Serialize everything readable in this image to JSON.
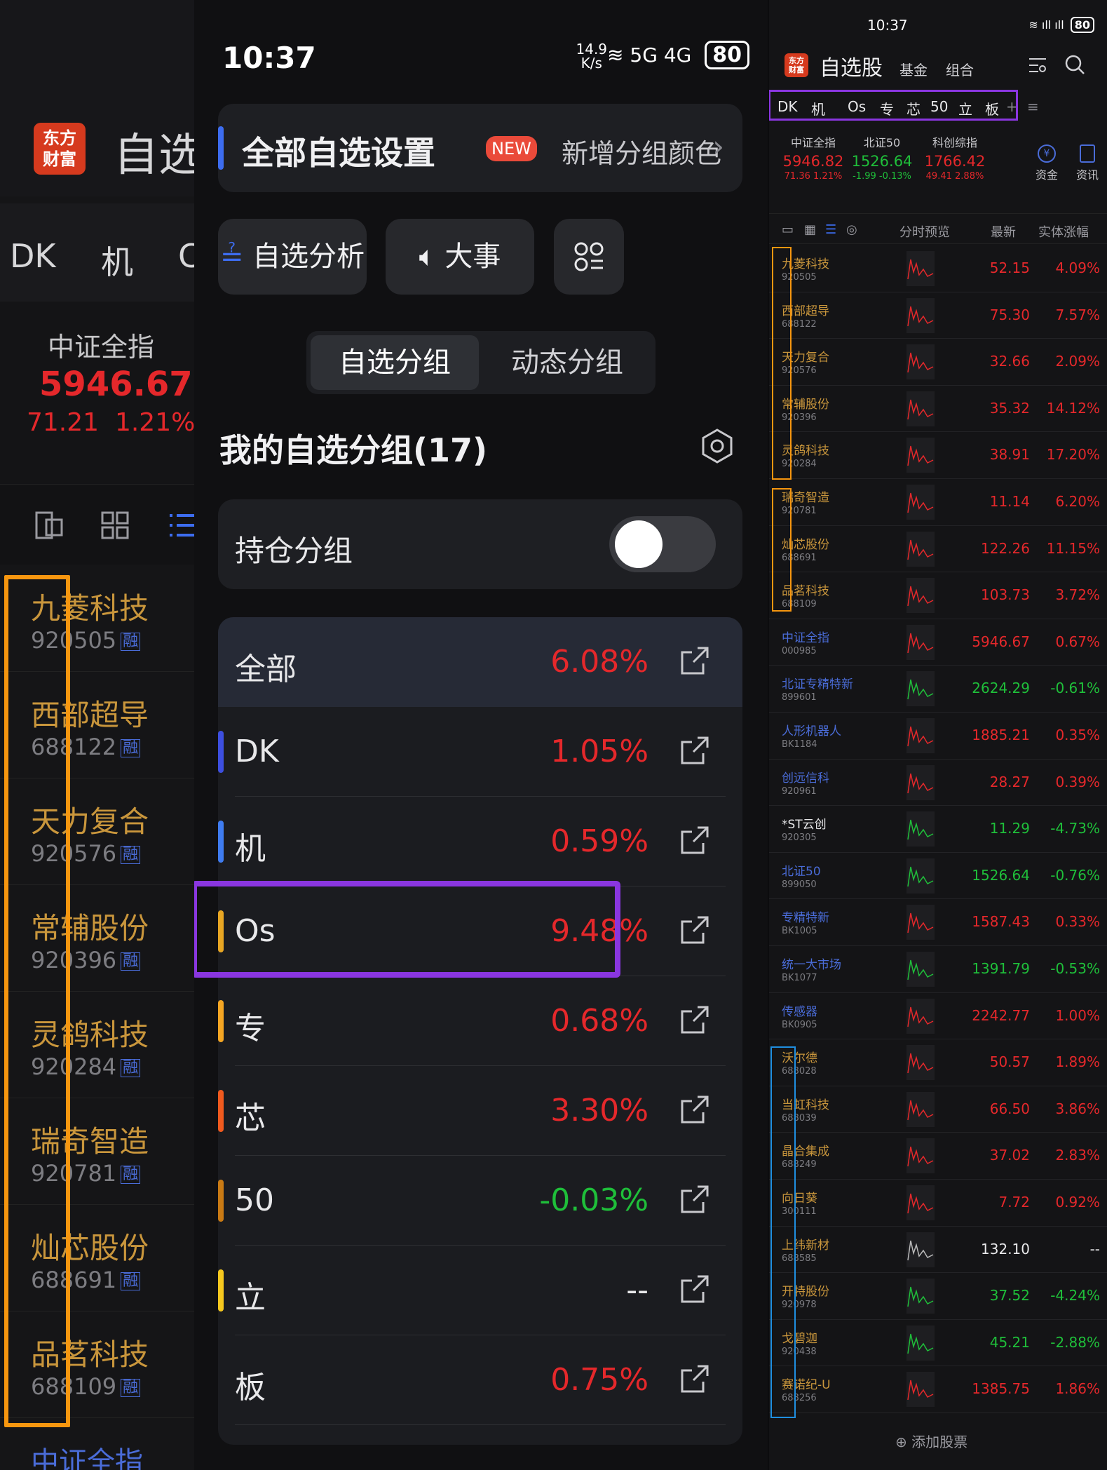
{
  "left": {
    "logo": "东方\n财富",
    "app_title": "自选",
    "tabs": [
      "DK",
      "机",
      "C"
    ],
    "index": {
      "name": "中证全指",
      "price": "5946.67",
      "change": "71.21",
      "pct": "1.21%"
    },
    "stocks": [
      {
        "name": "九菱科技",
        "code": "920505",
        "tag": "融"
      },
      {
        "name": "西部超导",
        "code": "688122",
        "tag": "融"
      },
      {
        "name": "天力复合",
        "code": "920576",
        "tag": "融"
      },
      {
        "name": "常辅股份",
        "code": "920396",
        "tag": "融"
      },
      {
        "name": "灵鸽科技",
        "code": "920284",
        "tag": "融"
      },
      {
        "name": "瑞奇智造",
        "code": "920781",
        "tag": "融"
      },
      {
        "name": "灿芯股份",
        "code": "688691",
        "tag": "融"
      },
      {
        "name": "品茗科技",
        "code": "688109",
        "tag": "融"
      }
    ],
    "bottom_item": "中证全指"
  },
  "mid": {
    "time": "10:37",
    "net_speed": "14.9\nK/s",
    "signal": "5G 4G",
    "battery": "80",
    "settings_title": "全部自选设置",
    "new_badge": "NEW",
    "new_text": "新增分组颜色",
    "btn_analysis": "自选分析",
    "btn_events": "大事",
    "seg_left": "自选分组",
    "seg_right": "动态分组",
    "my_groups": "我的自选分组(17)",
    "hold_group": "持仓分组",
    "groups": [
      {
        "name": "全部",
        "pct": "6.08%",
        "color": "",
        "tone": "red"
      },
      {
        "name": "DK",
        "pct": "1.05%",
        "color": "#3d4fe0",
        "tone": "red"
      },
      {
        "name": "机",
        "pct": "0.59%",
        "color": "#3f7cf0",
        "tone": "red"
      },
      {
        "name": "Os",
        "pct": "9.48%",
        "color": "#e8a623",
        "tone": "red"
      },
      {
        "name": "专",
        "pct": "0.68%",
        "color": "#f5a623",
        "tone": "red"
      },
      {
        "name": "芯",
        "pct": "3.30%",
        "color": "#f05a1e",
        "tone": "red"
      },
      {
        "name": "50",
        "pct": "-0.03%",
        "color": "#c97a14",
        "tone": "green"
      },
      {
        "name": "立",
        "pct": "--",
        "color": "#f6c81e",
        "tone": "white"
      },
      {
        "name": "板",
        "pct": "0.75%",
        "color": "",
        "tone": "red"
      }
    ]
  },
  "right": {
    "time": "10:37",
    "battery": "80",
    "logo": "东方\n财富",
    "title": "自选股",
    "sub_fund": "基金",
    "sub_combo": "组合",
    "tabs": [
      "DK",
      "机",
      "Os",
      "专",
      "芯",
      "50",
      "立",
      "板",
      "+",
      "≡"
    ],
    "indices": [
      {
        "name": "中证全指",
        "price": "5946.82",
        "chg": "71.36",
        "pct": "1.21%",
        "tone": "red"
      },
      {
        "name": "北证50",
        "price": "1526.64",
        "chg": "-1.99",
        "pct": "-0.13%",
        "tone": "green"
      },
      {
        "name": "科创综指",
        "price": "1766.42",
        "chg": "49.41",
        "pct": "2.88%",
        "tone": "red"
      }
    ],
    "fund_label": "资金",
    "news_label": "资讯",
    "col_preview": "分时预览",
    "col_latest": "最新",
    "col_change": "实体涨幅",
    "rows": [
      {
        "name": "九菱科技",
        "code": "920505",
        "price": "52.15",
        "pct": "4.09%",
        "tone": "red",
        "kind": "gold"
      },
      {
        "name": "西部超导",
        "code": "688122",
        "price": "75.30",
        "pct": "7.57%",
        "tone": "red",
        "kind": "gold"
      },
      {
        "name": "天力复合",
        "code": "920576",
        "price": "32.66",
        "pct": "2.09%",
        "tone": "red",
        "kind": "gold"
      },
      {
        "name": "常辅股份",
        "code": "920396",
        "price": "35.32",
        "pct": "14.12%",
        "tone": "red",
        "kind": "gold"
      },
      {
        "name": "灵鸽科技",
        "code": "920284",
        "price": "38.91",
        "pct": "17.20%",
        "tone": "red",
        "kind": "gold"
      },
      {
        "name": "瑞奇智造",
        "code": "920781",
        "price": "11.14",
        "pct": "6.20%",
        "tone": "red",
        "kind": "gold"
      },
      {
        "name": "灿芯股份",
        "code": "688691",
        "price": "122.26",
        "pct": "11.15%",
        "tone": "red",
        "kind": "gold"
      },
      {
        "name": "品茗科技",
        "code": "688109",
        "price": "103.73",
        "pct": "3.72%",
        "tone": "red",
        "kind": "gold"
      },
      {
        "name": "中证全指",
        "code": "000985",
        "price": "5946.67",
        "pct": "0.67%",
        "tone": "red",
        "kind": "blue"
      },
      {
        "name": "北证专精特新",
        "code": "899601",
        "price": "2624.29",
        "pct": "-0.61%",
        "tone": "green",
        "kind": "blue"
      },
      {
        "name": "人形机器人",
        "code": "BK1184",
        "price": "1885.21",
        "pct": "0.35%",
        "tone": "red",
        "kind": "blue"
      },
      {
        "name": "创远信科",
        "code": "920961",
        "price": "28.27",
        "pct": "0.39%",
        "tone": "red",
        "kind": "blue"
      },
      {
        "name": "*ST云创",
        "code": "920305",
        "price": "11.29",
        "pct": "-4.73%",
        "tone": "green",
        "kind": "white"
      },
      {
        "name": "北证50",
        "code": "899050",
        "price": "1526.64",
        "pct": "-0.76%",
        "tone": "green",
        "kind": "blue"
      },
      {
        "name": "专精特新",
        "code": "BK1005",
        "price": "1587.43",
        "pct": "0.33%",
        "tone": "red",
        "kind": "blue"
      },
      {
        "name": "统一大市场",
        "code": "BK1077",
        "price": "1391.79",
        "pct": "-0.53%",
        "tone": "green",
        "kind": "blue"
      },
      {
        "name": "传感器",
        "code": "BK0905",
        "price": "2242.77",
        "pct": "1.00%",
        "tone": "red",
        "kind": "blue"
      },
      {
        "name": "沃尔德",
        "code": "688028",
        "price": "50.57",
        "pct": "1.89%",
        "tone": "red",
        "kind": "gold"
      },
      {
        "name": "当虹科技",
        "code": "688039",
        "price": "66.50",
        "pct": "3.86%",
        "tone": "red",
        "kind": "gold"
      },
      {
        "name": "晶合集成",
        "code": "688249",
        "price": "37.02",
        "pct": "2.83%",
        "tone": "red",
        "kind": "gold"
      },
      {
        "name": "向日葵",
        "code": "300111",
        "price": "7.72",
        "pct": "0.92%",
        "tone": "red",
        "kind": "gold"
      },
      {
        "name": "上纬新材",
        "code": "688585",
        "price": "132.10",
        "pct": "--",
        "tone": "white",
        "kind": "gold"
      },
      {
        "name": "开特股份",
        "code": "920978",
        "price": "37.52",
        "pct": "-4.24%",
        "tone": "green",
        "kind": "gold"
      },
      {
        "name": "戈碧迦",
        "code": "920438",
        "price": "45.21",
        "pct": "-2.88%",
        "tone": "green",
        "kind": "gold"
      },
      {
        "name": "赛诺纪-U",
        "code": "688256",
        "price": "1385.75",
        "pct": "1.86%",
        "tone": "red",
        "kind": "gold"
      }
    ],
    "add_stock": "⊕ 添加股票"
  }
}
